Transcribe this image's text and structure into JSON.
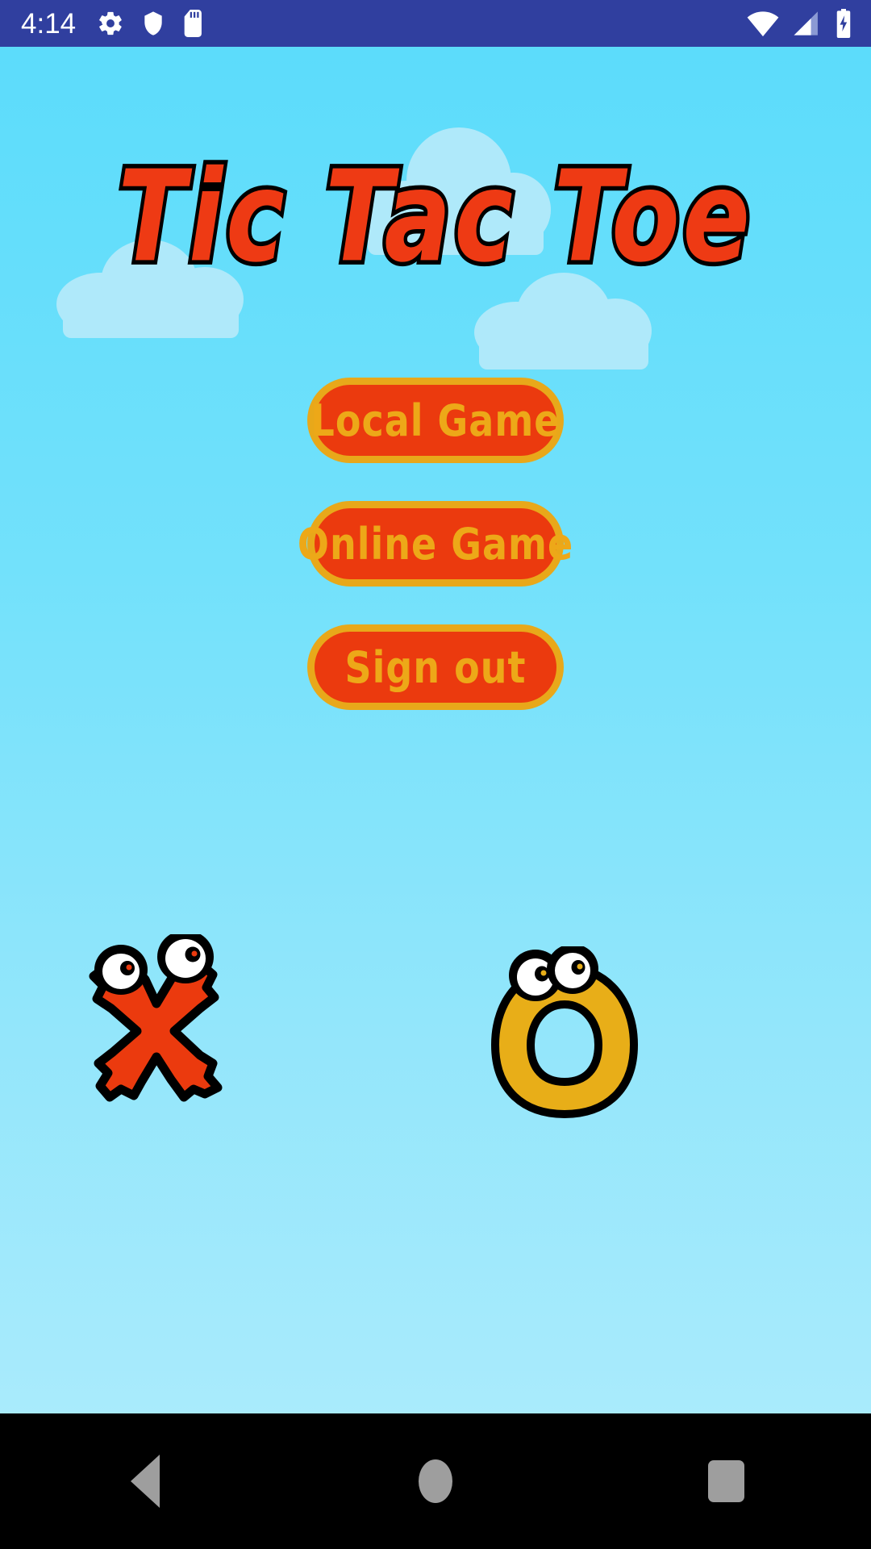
{
  "status_bar": {
    "time": "4:14",
    "background_color": "#303F9F",
    "left_icons": [
      {
        "name": "gear-icon",
        "label": "Settings"
      },
      {
        "name": "shield-icon",
        "label": "Security"
      },
      {
        "name": "sd-card-icon",
        "label": "SD card"
      }
    ],
    "right_icons": [
      {
        "name": "wifi-icon",
        "label": "Wi-Fi"
      },
      {
        "name": "cell-signal-icon",
        "label": "Signal"
      },
      {
        "name": "battery-charging-icon",
        "label": "Battery charging"
      }
    ]
  },
  "app": {
    "title": "Tic Tac Toe",
    "title_color": "#EE3A14",
    "title_outline_color": "#000000",
    "background_top_color": "#5CDCFB",
    "background_bottom_color": "#A9EBFC",
    "cloud_color": "#AFE9FA"
  },
  "menu": {
    "buttons": [
      {
        "label": "Local Game",
        "name": "local-game-button"
      },
      {
        "label": "Online Game",
        "name": "online-game-button"
      },
      {
        "label": "Sign out",
        "name": "sign-out-button"
      }
    ],
    "button_fill_color": "#EB3A0E",
    "button_border_color": "#E8A81A",
    "button_text_color": "#EDA818"
  },
  "mascots": [
    {
      "name": "x-mascot",
      "symbol": "X",
      "color": "#EB3A0E",
      "outline_color": "#000000"
    },
    {
      "name": "o-mascot",
      "symbol": "O",
      "color": "#E8AE18",
      "outline_color": "#000000"
    }
  ],
  "nav_bar": {
    "background_color": "#000000",
    "icon_color": "#9E9E9E",
    "buttons": [
      {
        "name": "nav-back-button",
        "label": "Back"
      },
      {
        "name": "nav-home-button",
        "label": "Home"
      },
      {
        "name": "nav-recents-button",
        "label": "Recent apps"
      }
    ]
  }
}
